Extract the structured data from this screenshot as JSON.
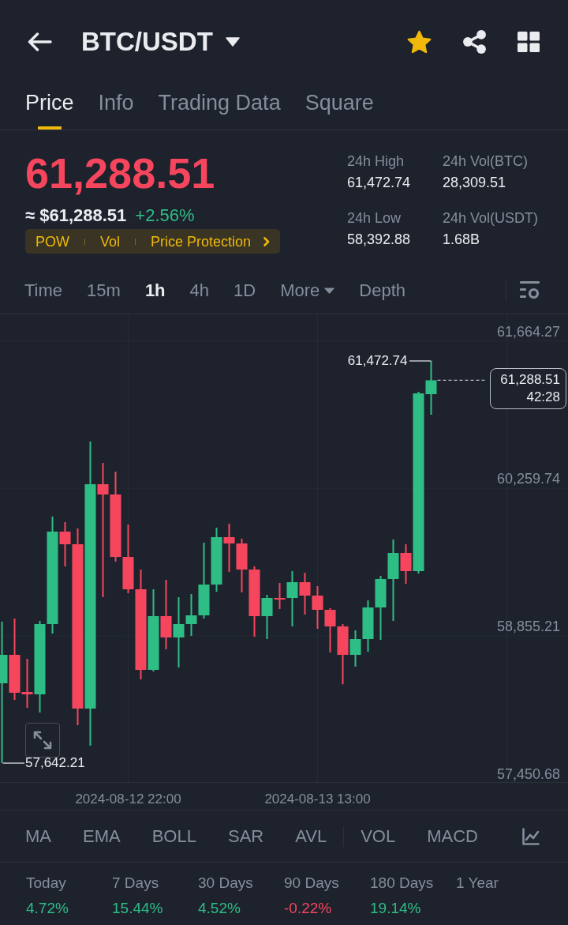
{
  "header": {
    "pair": "BTC/USDT",
    "favorite": true
  },
  "tabs": [
    {
      "label": "Price",
      "selected": true
    },
    {
      "label": "Info",
      "selected": false
    },
    {
      "label": "Trading Data",
      "selected": false
    },
    {
      "label": "Square",
      "selected": false
    }
  ],
  "price": {
    "last": "61,288.51",
    "last_up": false,
    "converted": "≈ $61,288.51",
    "change": "+2.56%",
    "change_up": true,
    "tags": [
      "POW",
      "Vol",
      "Price Protection"
    ]
  },
  "stats": [
    {
      "label": "24h High",
      "value": "61,472.74"
    },
    {
      "label": "24h Vol(BTC)",
      "value": "28,309.51"
    },
    {
      "label": "24h Low",
      "value": "58,392.88"
    },
    {
      "label": "24h Vol(USDT)",
      "value": "1.68B"
    }
  ],
  "intervals": [
    {
      "label": "Time",
      "selected": false,
      "dropdown": false
    },
    {
      "label": "15m",
      "selected": false,
      "dropdown": false
    },
    {
      "label": "1h",
      "selected": true,
      "dropdown": false
    },
    {
      "label": "4h",
      "selected": false,
      "dropdown": false
    },
    {
      "label": "1D",
      "selected": false,
      "dropdown": false
    },
    {
      "label": "More",
      "selected": false,
      "dropdown": true
    },
    {
      "label": "Depth",
      "selected": false,
      "dropdown": false
    }
  ],
  "chart": {
    "high_label": "61,472.74",
    "low_label": "57,642.21",
    "last_price": "61,288.51",
    "countdown": "42:28",
    "chart_data": {
      "type": "candlestick",
      "grid": true,
      "categories": [
        null,
        null,
        null,
        null,
        null,
        null,
        null,
        null,
        null,
        null,
        "2024-08-12 22:00",
        null,
        null,
        null,
        null,
        null,
        null,
        null,
        null,
        null,
        null,
        null,
        null,
        null,
        null,
        "2024-08-13 13:00",
        null,
        null,
        null,
        null,
        null,
        null,
        null,
        null,
        null
      ],
      "ohlc": [
        [
          58402.5,
          58989.4,
          57642.21,
          58673.4
        ],
        [
          58673.4,
          59019.5,
          58244.5,
          58312.2
        ],
        [
          58319.7,
          58635.7,
          58169.2,
          58297.1
        ],
        [
          58297.1,
          58996.9,
          58124.1,
          58966.8
        ],
        [
          58966.8,
          59990.1,
          58876.5,
          59847.2
        ],
        [
          59847.2,
          59937.4,
          59516.1,
          59726.8
        ],
        [
          59726.8,
          59877.2,
          58003.7,
          58161.7
        ],
        [
          58161.7,
          60704.9,
          57808.1,
          60298.6
        ],
        [
          60298.6,
          60501.8,
          59222.6,
          60200.8
        ],
        [
          60200.8,
          60419.0,
          59561.2,
          59606.4
        ],
        [
          59606.4,
          59914.9,
          59260.3,
          59297.9
        ],
        [
          59297.9,
          59486.0,
          58440.1,
          58530.4
        ],
        [
          58530.4,
          59297.9,
          58515.3,
          59042.1
        ],
        [
          59042.1,
          59388.2,
          58726.0,
          58838.9
        ],
        [
          58838.9,
          59222.6,
          58553.0,
          58966.8
        ],
        [
          58966.8,
          59252.7,
          58853.9,
          59049.6
        ],
        [
          59049.6,
          59741.8,
          59019.5,
          59343.0
        ],
        [
          59343.0,
          59884.8,
          59275.3,
          59794.5
        ],
        [
          59794.5,
          59922.4,
          59463.4,
          59734.3
        ],
        [
          59734.3,
          59779.4,
          59267.8,
          59486.0
        ],
        [
          59486.0,
          59516.1,
          58846.4,
          59042.1
        ],
        [
          59042.1,
          59245.2,
          58823.8,
          59215.1
        ],
        [
          59215.1,
          59358.1,
          59109.8,
          59200.1
        ],
        [
          59215.1,
          59470.9,
          58944.2,
          59365.6
        ],
        [
          59365.6,
          59455.9,
          59057.1,
          59237.7
        ],
        [
          59237.7,
          59328.0,
          58921.7,
          59102.2
        ],
        [
          59102.2,
          59117.3,
          58695.9,
          58944.2
        ],
        [
          58944.2,
          58966.8,
          58392.88,
          58673.4
        ],
        [
          58673.4,
          58906.6,
          58560.5,
          58823.8
        ],
        [
          58823.8,
          59192.5,
          58703.5,
          59124.8
        ],
        [
          59124.8,
          59425.8,
          58816.3,
          59395.7
        ],
        [
          59395.7,
          59771.9,
          58996.9,
          59644.0
        ],
        [
          59644.0,
          59726.8,
          59350.5,
          59470.9
        ],
        [
          59470.9,
          61179.0,
          59448.4,
          61163.9
        ],
        [
          61156.4,
          61472.74,
          60960.7,
          61288.51
        ]
      ],
      "ylim": [
        57450.68,
        61916.34
      ],
      "yticks": [
        {
          "value": 61664.27,
          "label": "61,664.27"
        },
        {
          "value": 60259.74,
          "label": "60,259.74"
        },
        {
          "value": 58855.21,
          "label": "58,855.21"
        },
        {
          "value": 57450.68,
          "label": "57,450.68"
        }
      ]
    }
  },
  "indicators": {
    "main": [
      {
        "label": "MA",
        "selected": false
      },
      {
        "label": "EMA",
        "selected": false
      },
      {
        "label": "BOLL",
        "selected": false
      },
      {
        "label": "SAR",
        "selected": false
      },
      {
        "label": "AVL",
        "selected": false
      }
    ],
    "sub": [
      {
        "label": "VOL",
        "selected": false
      },
      {
        "label": "MACD",
        "selected": false
      }
    ]
  },
  "performance": [
    {
      "label": "Today",
      "value": "4.72%",
      "up": true
    },
    {
      "label": "7 Days",
      "value": "15.44%",
      "up": true
    },
    {
      "label": "30 Days",
      "value": "4.52%",
      "up": true
    },
    {
      "label": "90 Days",
      "value": "-0.22%",
      "up": false
    },
    {
      "label": "180 Days",
      "value": "19.14%",
      "up": true
    },
    {
      "label": "1 Year"
    }
  ]
}
